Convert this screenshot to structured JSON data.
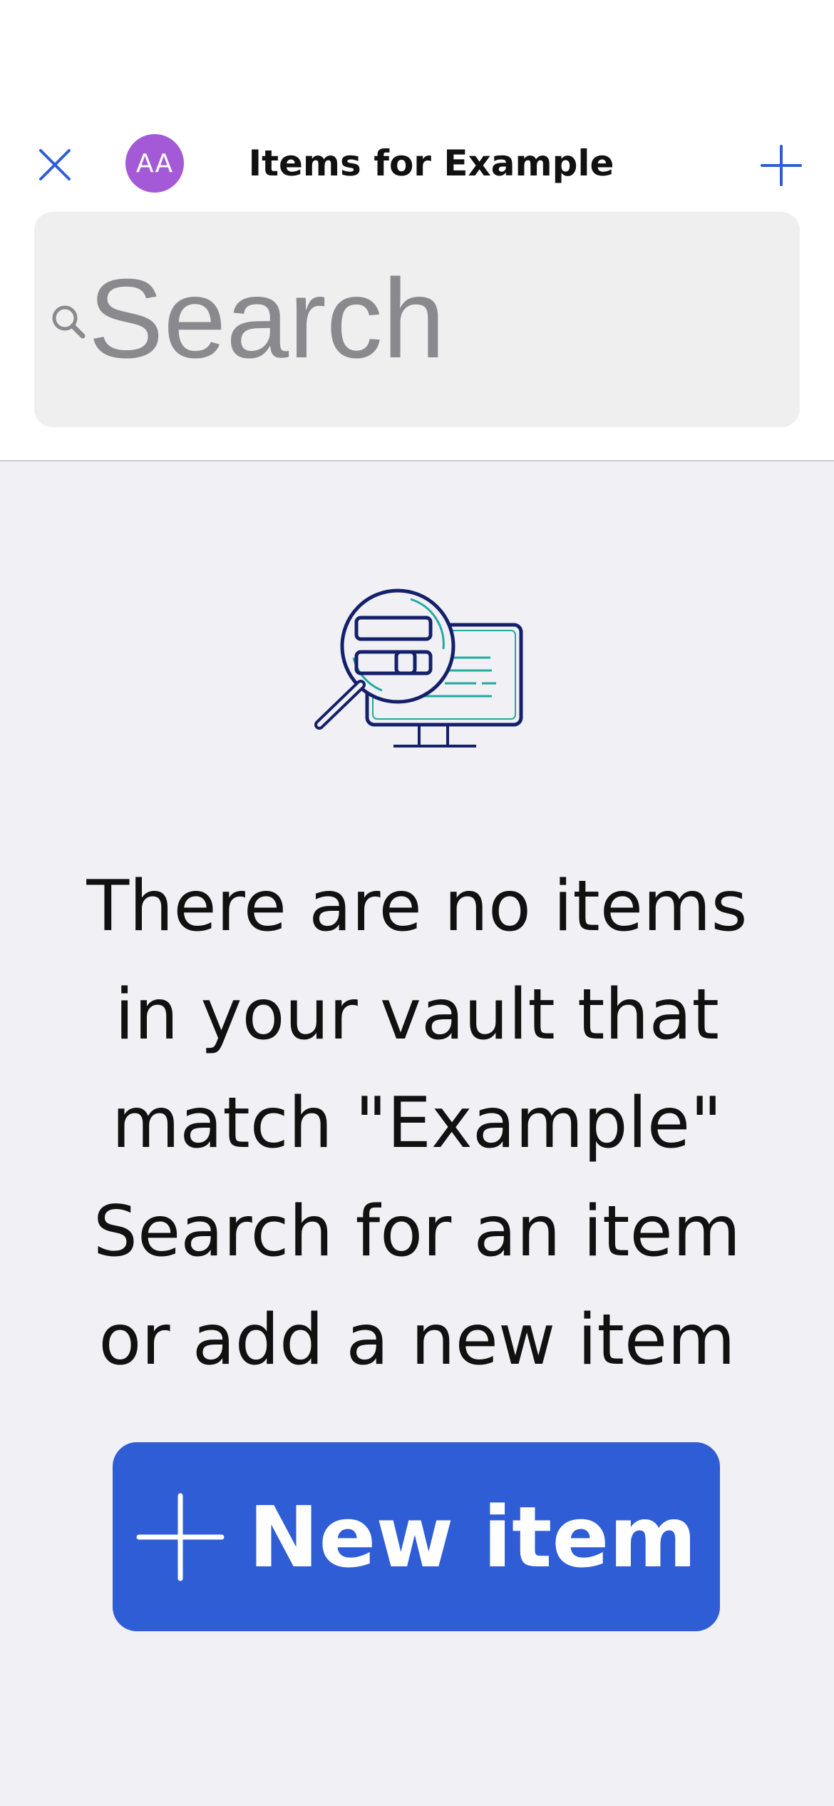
{
  "header": {
    "title": "Items for Example",
    "avatar_initials": "AA",
    "avatar_color": "#a45ad6",
    "close_icon": "close-icon",
    "add_icon": "plus-icon"
  },
  "search": {
    "placeholder": "Search",
    "value": ""
  },
  "empty_state": {
    "illustration": "search-magnifier-monitor-illustration",
    "message": "There are no items\nin your vault that\nmatch \"Example\"\nSearch for an item\nor add a new item"
  },
  "new_item_button": {
    "label": "New item"
  },
  "colors": {
    "accent": "#2f5dd6",
    "background": "#f0f0f5"
  }
}
